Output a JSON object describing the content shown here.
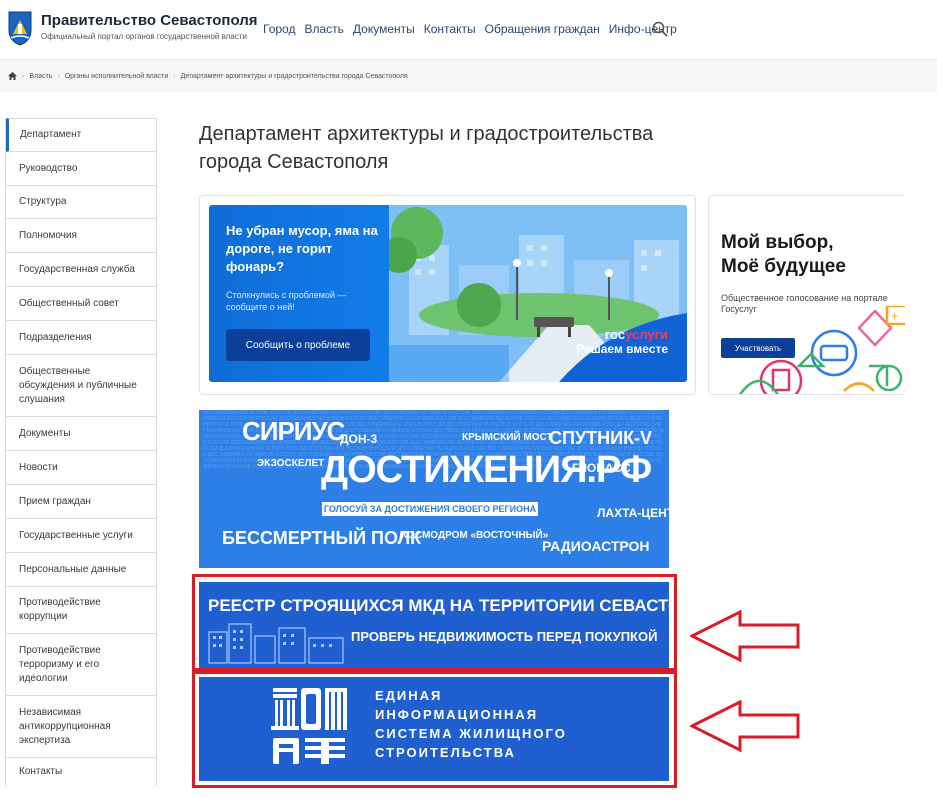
{
  "header": {
    "title": "Правительство Севастополя",
    "subtitle": "Официальный портал органов государственной власти",
    "nav": [
      "Город",
      "Власть",
      "Документы",
      "Контакты",
      "Обращения граждан",
      "Инфо-центр"
    ]
  },
  "breadcrumbs": [
    "Власть",
    "Органы исполнительной власти",
    "Департамент архитектуры и градостроительства города Севастополя"
  ],
  "sidebar": {
    "items": [
      {
        "label": "Департамент"
      },
      {
        "label": "Руководство"
      },
      {
        "label": "Структура"
      },
      {
        "label": "Полномочия"
      },
      {
        "label": "Государственная служба"
      },
      {
        "label": "Общественный совет"
      },
      {
        "label": "Подразделения"
      },
      {
        "label": "Общественные обсуждения и публичные слушания"
      },
      {
        "label": "Документы"
      },
      {
        "label": "Новости"
      },
      {
        "label": "Прием граждан"
      },
      {
        "label": "Государственные услуги"
      },
      {
        "label": "Персональные данные"
      },
      {
        "label": "Противодействие коррупции"
      },
      {
        "label": "Противодействие терроризму и его идеологии"
      },
      {
        "label": "Независимая антикоррупционная экспертиза"
      },
      {
        "label": "Контакты"
      }
    ]
  },
  "main": {
    "title": "Департамент архитектуры и градостроительства города Севастополя",
    "gosuslugi_banner": {
      "headline": "Не убран мусор, яма на дороге, не горит фонарь?",
      "text": "Столкнулись с проблемой — сообщите о ней!",
      "button": "Сообщить о проблеме",
      "brand_gos": "гос",
      "brand_uslugi": "услуги",
      "brand_tagline": "Решаем вместе"
    },
    "vote_banner": {
      "title_line1": "Мой выбор,",
      "title_line2": "Моё будущее",
      "subtitle": "Общественное голосование на портале Госуслуг",
      "button": "Участвовать"
    },
    "achievements_banner": {
      "words": [
        "СИРИУС",
        "ДОН-3",
        "КРЫМСКИЙ МОСТ",
        "СПУТНИК-V",
        "ЭКЗОСКЕЛЕТ",
        "ГЛОНАСС",
        "ДОСТИЖЕНИЯ.РФ",
        "ЛАХТА-ЦЕНТР",
        "БЕССМЕРТНЫЙ ПОЛК",
        "КОСМОДРОМ «ВОСТОЧНЫЙ»",
        "РАДИОАСТРОН"
      ],
      "slogan": "ГОЛОСУЙ ЗА ДОСТИЖЕНИЯ СВОЕГО РЕГИОНА"
    },
    "registry_banner": {
      "title": "РЕЕСТР СТРОЯЩИХСЯ МКД НА ТЕРРИТОРИИ СЕВАСТОПОЛЯ",
      "subtitle": "ПРОВЕРЬ НЕДВИЖИМОСТЬ ПЕРЕД ПОКУПКОЙ"
    },
    "dom_banner": {
      "lines": [
        "ЕДИНАЯ",
        "ИНФОРМАЦИОННАЯ",
        "СИСТЕМА ЖИЛИЩНОГО",
        "СТРОИТЕЛЬСТВА"
      ]
    }
  },
  "colors": {
    "accent_blue": "#1f5fd0",
    "highlight_red": "#d81d27",
    "gos_red": "#ee3f58"
  }
}
